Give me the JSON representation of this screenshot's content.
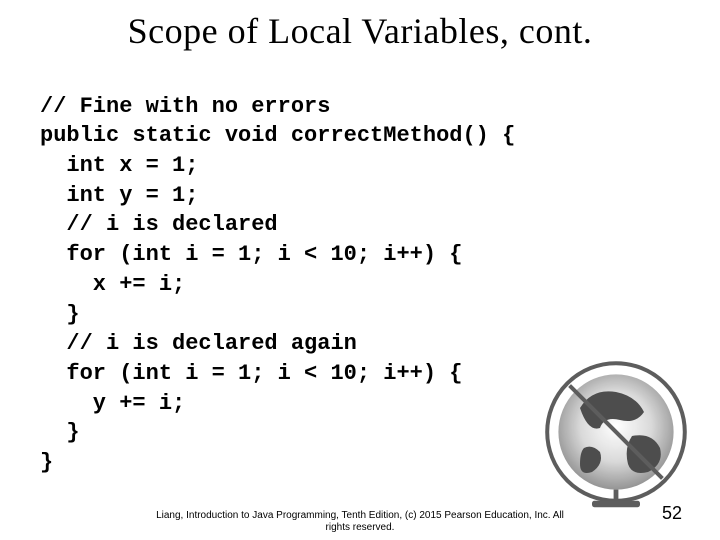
{
  "title": "Scope of Local Variables, cont.",
  "code": {
    "l1": "// Fine with no errors",
    "l2": "public static void correctMethod() {",
    "l3": "  int x = 1;",
    "l4": "  int y = 1;",
    "l5": "  // i is declared",
    "l6": "  for (int i = 1; i < 10; i++) {",
    "l7": "    x += i;",
    "l8": "  }",
    "l9": "  // i is declared again",
    "l10": "  for (int i = 1; i < 10; i++) {",
    "l11": "    y += i;",
    "l12": "  }",
    "l13": "}"
  },
  "footer_line1": "Liang, Introduction to Java Programming, Tenth Edition, (c) 2015 Pearson Education, Inc. All",
  "footer_line2": "rights reserved.",
  "page_number": "52"
}
